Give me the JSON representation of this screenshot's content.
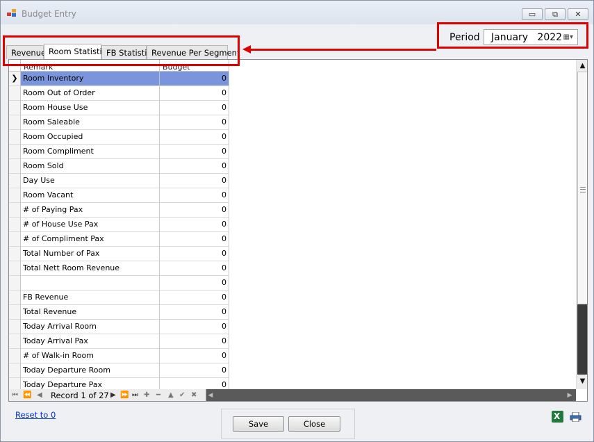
{
  "window": {
    "title": "Budget Entry",
    "minimize": "▭",
    "restore": "⧉",
    "close": "✕"
  },
  "period": {
    "label": "Period",
    "value": "January   2022"
  },
  "tabs": [
    {
      "label": "Revenue"
    },
    {
      "label": "Room Statistic"
    },
    {
      "label": "FB Statistic"
    },
    {
      "label": "Revenue Per Segment"
    }
  ],
  "grid": {
    "headers": [
      "Remark",
      "Budget"
    ],
    "rows": [
      {
        "remark": "Room Inventory",
        "budget": "0"
      },
      {
        "remark": "Room Out of Order",
        "budget": "0"
      },
      {
        "remark": "Room House Use",
        "budget": "0"
      },
      {
        "remark": "Room Saleable",
        "budget": "0"
      },
      {
        "remark": "Room Occupied",
        "budget": "0"
      },
      {
        "remark": "Room Compliment",
        "budget": "0"
      },
      {
        "remark": "Room Sold",
        "budget": "0"
      },
      {
        "remark": "Day Use",
        "budget": "0"
      },
      {
        "remark": "Room Vacant",
        "budget": "0"
      },
      {
        "remark": "# of Paying Pax",
        "budget": "0"
      },
      {
        "remark": "# of House Use Pax",
        "budget": "0"
      },
      {
        "remark": "# of Compliment Pax",
        "budget": "0"
      },
      {
        "remark": "Total Number of Pax",
        "budget": "0"
      },
      {
        "remark": "Total Nett Room Revenue",
        "budget": "0"
      },
      {
        "remark": "",
        "budget": "0"
      },
      {
        "remark": "FB Revenue",
        "budget": "0"
      },
      {
        "remark": "Total Revenue",
        "budget": "0"
      },
      {
        "remark": "Today Arrival Room",
        "budget": "0"
      },
      {
        "remark": "Today Arrival Pax",
        "budget": "0"
      },
      {
        "remark": "# of Walk-in Room",
        "budget": "0"
      },
      {
        "remark": "Today Departure Room",
        "budget": "0"
      },
      {
        "remark": "Today Departure Pax",
        "budget": "0"
      }
    ],
    "row_indicator": "❯"
  },
  "navigator": {
    "record_text": "Record 1 of 27"
  },
  "footer": {
    "reset_link": "Reset to 0",
    "save": "Save",
    "close": "Close"
  },
  "colors": {
    "highlight": "#e00000",
    "selection": "#7b95dc"
  }
}
